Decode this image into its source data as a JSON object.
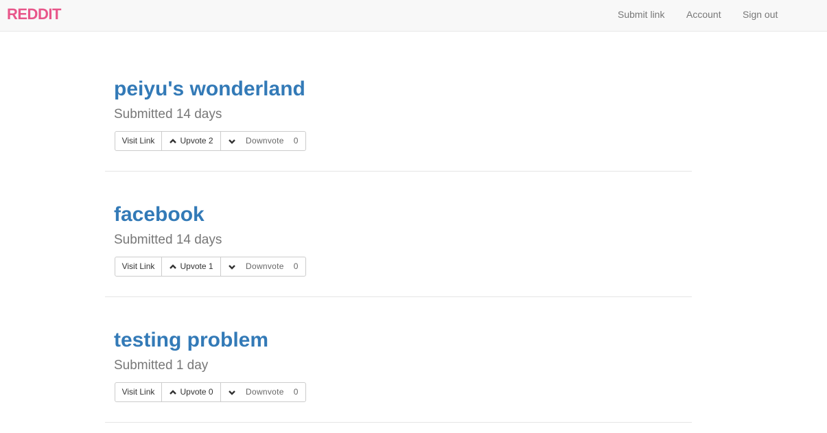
{
  "navbar": {
    "brand": "REDDIT",
    "links": [
      "Submit link",
      "Account",
      "Sign out"
    ]
  },
  "posts": [
    {
      "title": "peiyu's wonderland",
      "meta": "Submitted 14 days",
      "visit_label": "Visit Link",
      "upvote_label": "Upvote 2",
      "downvote_label": "Downvote",
      "downvote_count": "0"
    },
    {
      "title": "facebook",
      "meta": "Submitted 14 days",
      "visit_label": "Visit Link",
      "upvote_label": "Upvote 1",
      "downvote_label": "Downvote",
      "downvote_count": "0"
    },
    {
      "title": "testing problem",
      "meta": "Submitted 1 day",
      "visit_label": "Visit Link",
      "upvote_label": "Upvote 0",
      "downvote_label": "Downvote",
      "downvote_count": "0"
    }
  ],
  "icons": {
    "upvote": "chevron-up-icon",
    "downvote": "chevron-down-icon"
  },
  "colors": {
    "brand": "#e8568a",
    "link": "#337ab7",
    "muted": "#777777"
  }
}
